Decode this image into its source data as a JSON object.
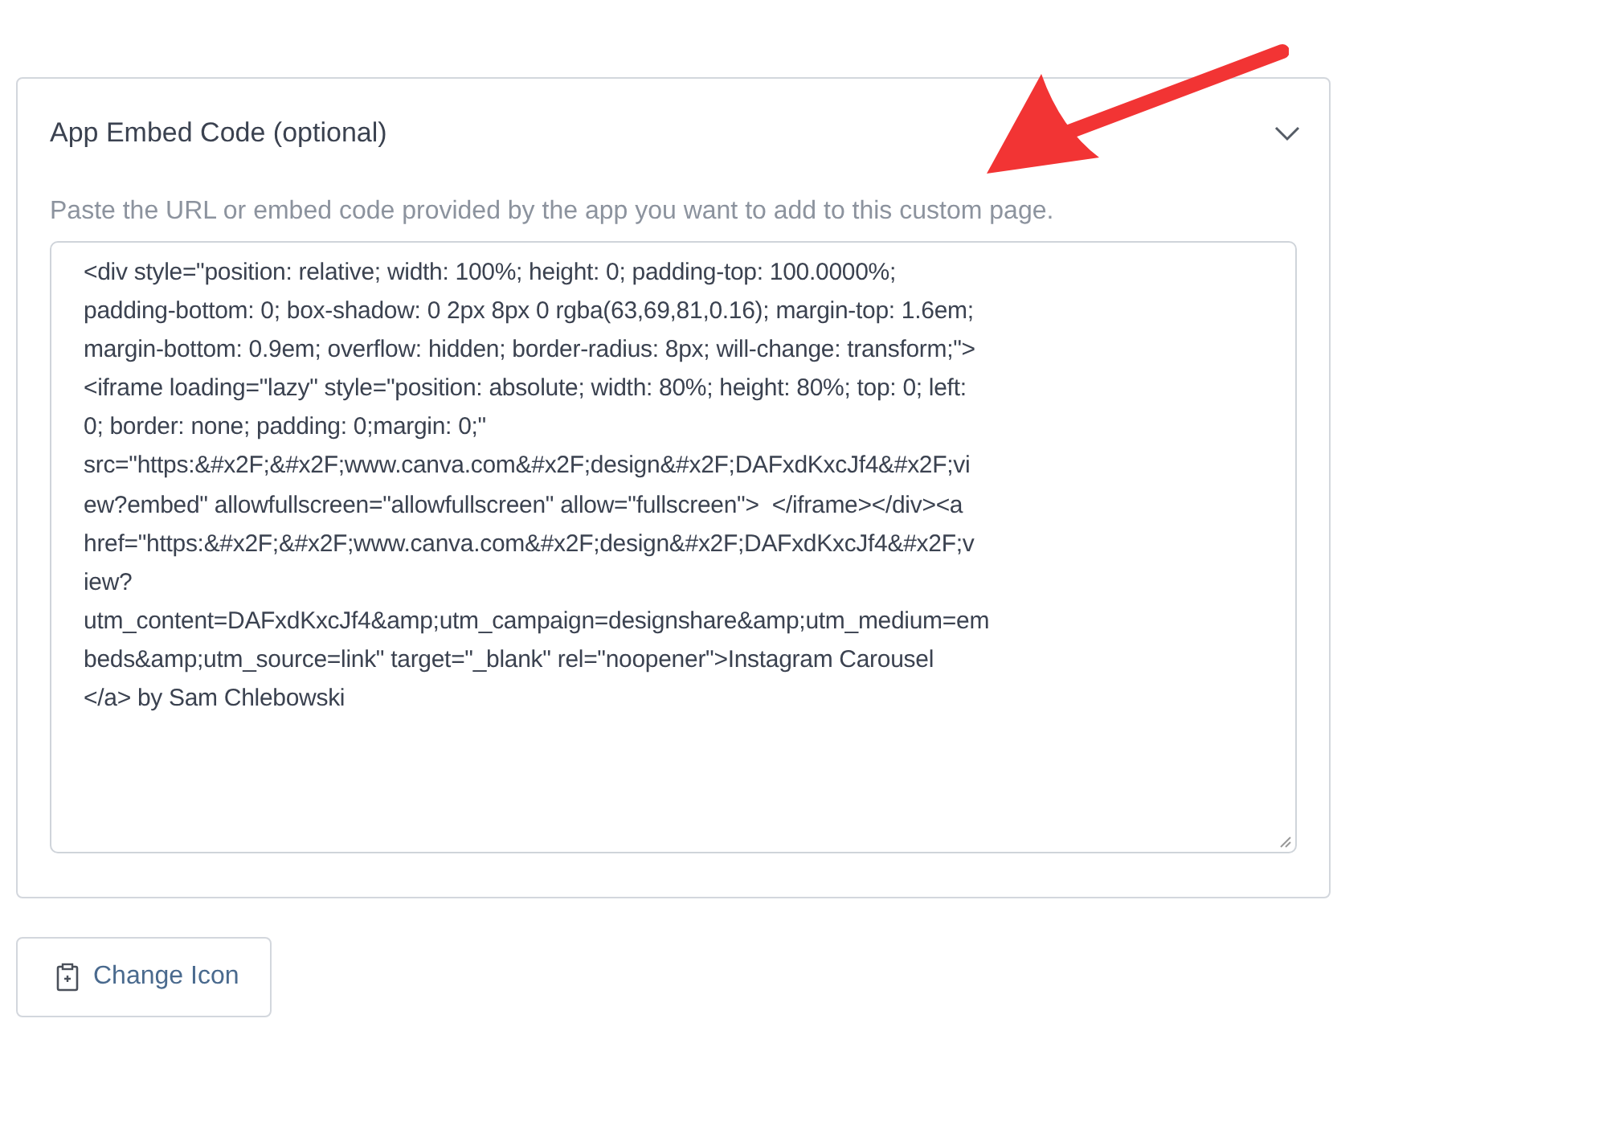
{
  "panel": {
    "title": "App Embed Code (optional)",
    "expanded": true,
    "hint": "Paste the URL or embed code provided by the app you want to add to this custom page.",
    "embed_code": {
      "value": "<div style=\"position: relative; width: 100%; height: 0; padding-top: 100.0000%;\npadding-bottom: 0; box-shadow: 0 2px 8px 0 rgba(63,69,81,0.16); margin-top: 1.6em;\nmargin-bottom: 0.9em; overflow: hidden; border-radius: 8px; will-change: transform;\">\n<iframe loading=\"lazy\" style=\"position: absolute; width: 80%; height: 80%; top: 0; left:\n0; border: none; padding: 0;margin: 0;\"\nsrc=\"https:&#x2F;&#x2F;www.canva.com&#x2F;design&#x2F;DAFxdKxcJf4&#x2F;vi\new?embed\" allowfullscreen=\"allowfullscreen\" allow=\"fullscreen\">  </iframe></div><a\nhref=\"https:&#x2F;&#x2F;www.canva.com&#x2F;design&#x2F;DAFxdKxcJf4&#x2F;v\niew?\nutm_content=DAFxdKxcJf4&amp;utm_campaign=designshare&amp;utm_medium=em\nbeds&amp;utm_source=link\" target=\"_blank\" rel=\"noopener\">Instagram Carousel\n</a> by Sam Chlebowski"
    }
  },
  "buttons": [
    {
      "label": "Change Icon"
    }
  ]
}
